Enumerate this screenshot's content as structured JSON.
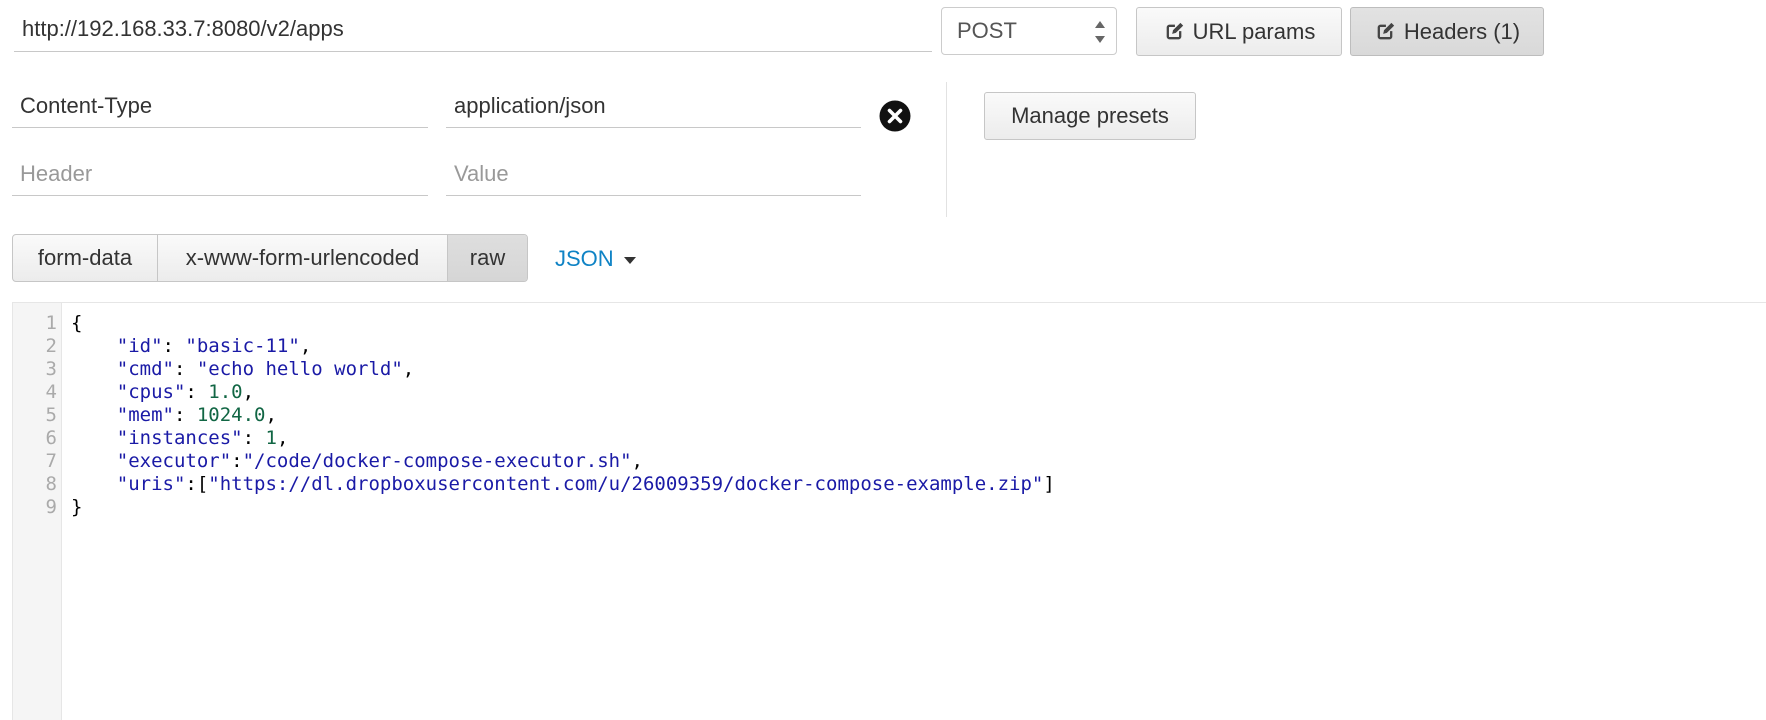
{
  "request": {
    "url": "http://192.168.33.7:8080/v2/apps",
    "method": "POST",
    "url_params_label": "URL params",
    "headers_label": "Headers (1)"
  },
  "headers": {
    "rows": [
      {
        "name": "Content-Type",
        "value": "application/json"
      }
    ],
    "new_row": {
      "name_placeholder": "Header",
      "value_placeholder": "Value"
    },
    "manage_presets_label": "Manage presets"
  },
  "body": {
    "tabs": [
      {
        "label": "form-data",
        "active": false
      },
      {
        "label": "x-www-form-urlencoded",
        "active": false
      },
      {
        "label": "raw",
        "active": true
      }
    ],
    "format_label": "JSON",
    "editor": {
      "line_numbers": [
        "1",
        "2",
        "3",
        "4",
        "5",
        "6",
        "7",
        "8",
        "9"
      ],
      "lines": [
        [
          {
            "t": "punc",
            "v": "{"
          }
        ],
        [
          {
            "t": "punc",
            "v": "    "
          },
          {
            "t": "key",
            "v": "\"id\""
          },
          {
            "t": "punc",
            "v": ": "
          },
          {
            "t": "str",
            "v": "\"basic-11\""
          },
          {
            "t": "punc",
            "v": ","
          }
        ],
        [
          {
            "t": "punc",
            "v": "    "
          },
          {
            "t": "key",
            "v": "\"cmd\""
          },
          {
            "t": "punc",
            "v": ": "
          },
          {
            "t": "str",
            "v": "\"echo hello world\""
          },
          {
            "t": "punc",
            "v": ","
          }
        ],
        [
          {
            "t": "punc",
            "v": "    "
          },
          {
            "t": "key",
            "v": "\"cpus\""
          },
          {
            "t": "punc",
            "v": ": "
          },
          {
            "t": "num",
            "v": "1.0"
          },
          {
            "t": "punc",
            "v": ","
          }
        ],
        [
          {
            "t": "punc",
            "v": "    "
          },
          {
            "t": "key",
            "v": "\"mem\""
          },
          {
            "t": "punc",
            "v": ": "
          },
          {
            "t": "num",
            "v": "1024.0"
          },
          {
            "t": "punc",
            "v": ","
          }
        ],
        [
          {
            "t": "punc",
            "v": "    "
          },
          {
            "t": "key",
            "v": "\"instances\""
          },
          {
            "t": "punc",
            "v": ": "
          },
          {
            "t": "num",
            "v": "1"
          },
          {
            "t": "punc",
            "v": ","
          }
        ],
        [
          {
            "t": "punc",
            "v": "    "
          },
          {
            "t": "key",
            "v": "\"executor\""
          },
          {
            "t": "punc",
            "v": ":"
          },
          {
            "t": "str",
            "v": "\"/code/docker-compose-executor.sh\""
          },
          {
            "t": "punc",
            "v": ","
          }
        ],
        [
          {
            "t": "punc",
            "v": "    "
          },
          {
            "t": "key",
            "v": "\"uris\""
          },
          {
            "t": "punc",
            "v": ":["
          },
          {
            "t": "str",
            "v": "\"https://dl.dropboxusercontent.com/u/26009359/docker-compose-example.zip\""
          },
          {
            "t": "punc",
            "v": "]"
          }
        ],
        [
          {
            "t": "punc",
            "v": "}"
          }
        ]
      ]
    }
  },
  "colors": {
    "link": "#0f83c5",
    "json_string": "#1a1aa6",
    "json_number": "#116644"
  }
}
